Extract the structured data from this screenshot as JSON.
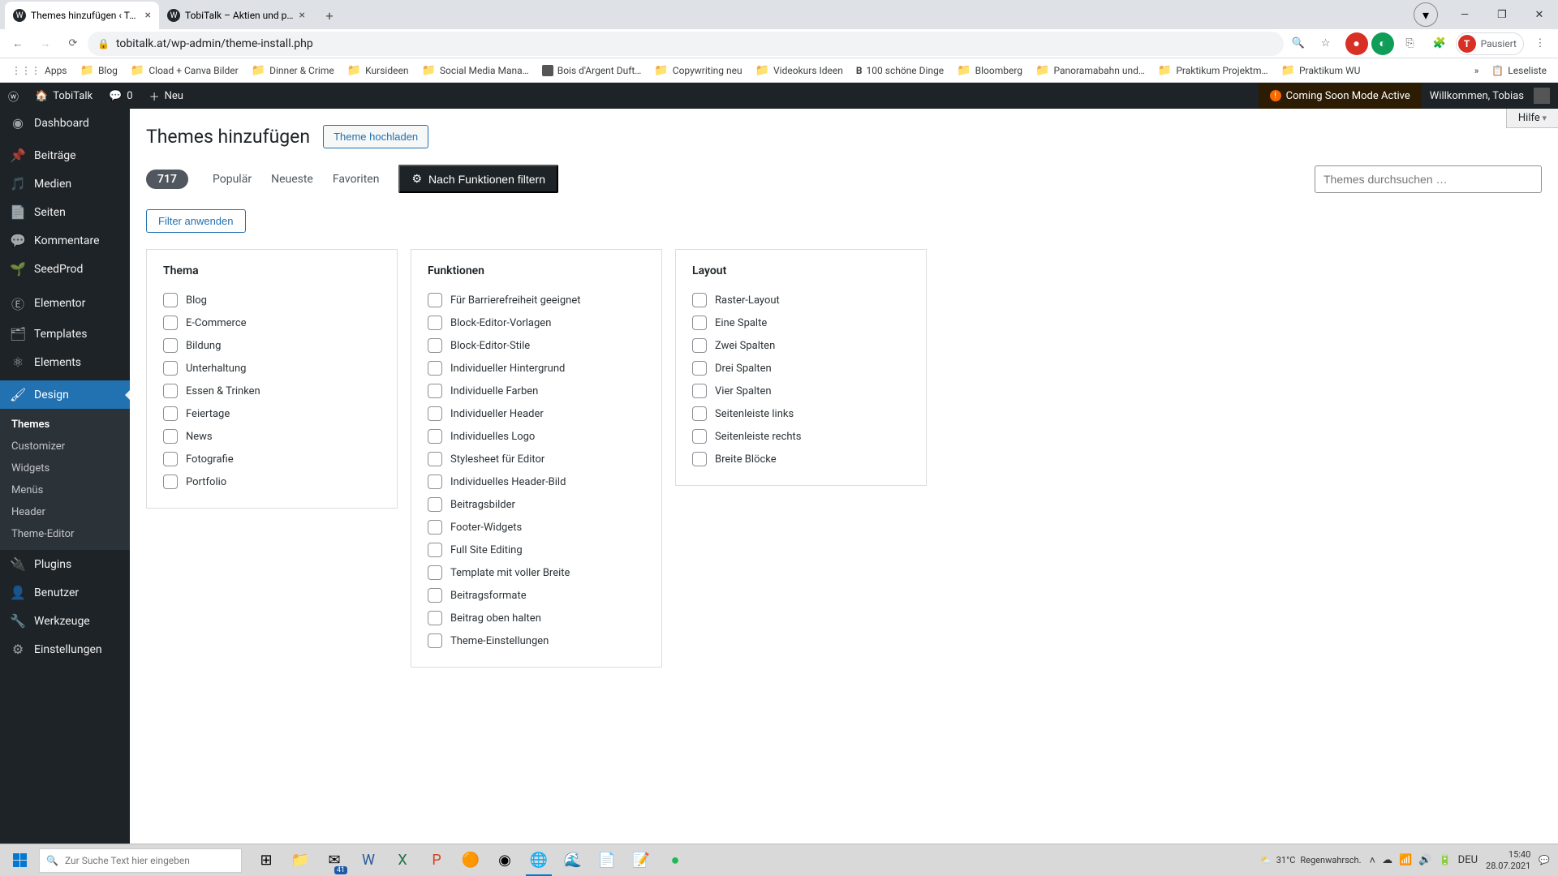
{
  "browser": {
    "tabs": [
      {
        "title": "Themes hinzufügen ‹ TobiTalk — …",
        "active": true
      },
      {
        "title": "TobiTalk – Aktien und persönlich…",
        "active": false
      }
    ],
    "url": "tobitalk.at/wp-admin/theme-install.php",
    "profile_status": "Pausiert",
    "profile_letter": "T"
  },
  "bookmarks": [
    "Apps",
    "Blog",
    "Cload + Canva Bilder",
    "Dinner & Crime",
    "Kursideen",
    "Social Media Mana…",
    "Bois d'Argent Duft…",
    "Copywriting neu",
    "Videokurs Ideen",
    "100 schöne Dinge",
    "Bloomberg",
    "Panoramabahn und…",
    "Praktikum Projektm…",
    "Praktikum WU"
  ],
  "bookmarks_overflow": "»",
  "bookmarks_readlist": "Leseliste",
  "adminbar": {
    "site": "TobiTalk",
    "comments": "0",
    "new": "Neu",
    "coming_soon": "Coming Soon Mode Active",
    "welcome": "Willkommen, Tobias"
  },
  "menu": {
    "dashboard": "Dashboard",
    "posts": "Beiträge",
    "media": "Medien",
    "pages": "Seiten",
    "comments": "Kommentare",
    "seedprod": "SeedProd",
    "elementor": "Elementor",
    "templates": "Templates",
    "elements": "Elements",
    "design": "Design",
    "design_sub": {
      "themes": "Themes",
      "customizer": "Customizer",
      "widgets": "Widgets",
      "menus": "Menüs",
      "header": "Header",
      "theme_editor": "Theme-Editor"
    },
    "plugins": "Plugins",
    "users": "Benutzer",
    "tools": "Werkzeuge",
    "settings": "Einstellungen"
  },
  "page": {
    "title": "Themes hinzufügen",
    "upload": "Theme hochladen",
    "help": "Hilfe",
    "count": "717",
    "tabs": {
      "popular": "Populär",
      "newest": "Neueste",
      "favorites": "Favoriten",
      "feature": "Nach Funktionen filtern"
    },
    "search_placeholder": "Themes durchsuchen …",
    "apply": "Filter anwenden"
  },
  "filters": {
    "thema": {
      "title": "Thema",
      "items": [
        "Blog",
        "E-Commerce",
        "Bildung",
        "Unterhaltung",
        "Essen & Trinken",
        "Feiertage",
        "News",
        "Fotografie",
        "Portfolio"
      ]
    },
    "funktionen": {
      "title": "Funktionen",
      "items": [
        "Für Barrierefreiheit geeignet",
        "Block-Editor-Vorlagen",
        "Block-Editor-Stile",
        "Individueller Hintergrund",
        "Individuelle Farben",
        "Individueller Header",
        "Individuelles Logo",
        "Stylesheet für Editor",
        "Individuelles Header-Bild",
        "Beitragsbilder",
        "Footer-Widgets",
        "Full Site Editing",
        "Template mit voller Breite",
        "Beitragsformate",
        "Beitrag oben halten",
        "Theme-Einstellungen"
      ]
    },
    "layout": {
      "title": "Layout",
      "items": [
        "Raster-Layout",
        "Eine Spalte",
        "Zwei Spalten",
        "Drei Spalten",
        "Vier Spalten",
        "Seitenleiste links",
        "Seitenleiste rechts",
        "Breite Blöcke"
      ]
    }
  },
  "taskbar": {
    "search_placeholder": "Zur Suche Text hier eingeben",
    "weather_temp": "31°C",
    "weather_text": "Regenwahrsch.",
    "lang": "DEU",
    "time": "15:40",
    "date": "28.07.2021"
  }
}
